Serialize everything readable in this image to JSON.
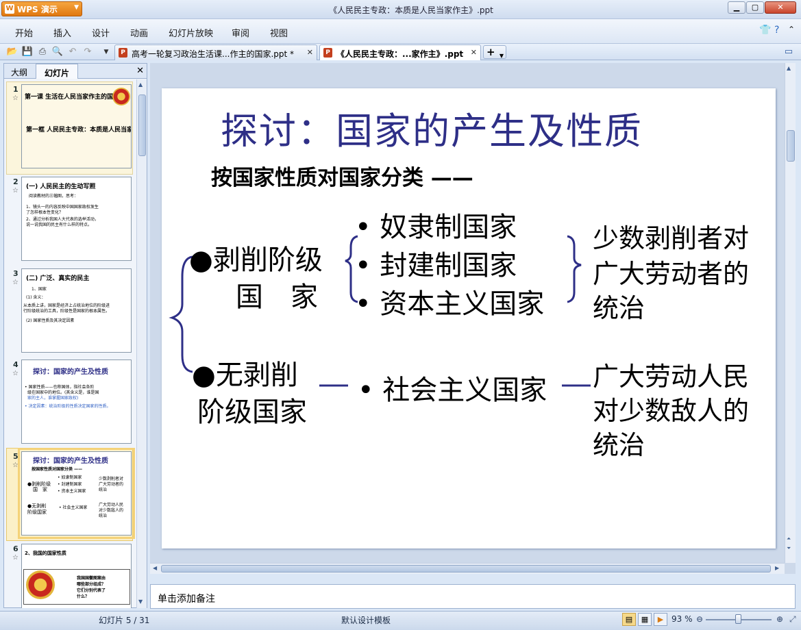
{
  "app": {
    "name": "WPS 演示",
    "window_title": "《人民民主专政：本质是人民当家作主》.ppt"
  },
  "menu": [
    "开始",
    "插入",
    "设计",
    "动画",
    "幻灯片放映",
    "审阅",
    "视图"
  ],
  "doc_tabs": [
    {
      "label": "高考一轮复习政治生活课...作主的国家.ppt *",
      "active": false
    },
    {
      "label": "《人民民主专政：...家作主》.ppt",
      "active": true
    }
  ],
  "left_pane": {
    "tab_outline": "大纲",
    "tab_slides": "幻灯片"
  },
  "thumbnails": [
    {
      "num": "1",
      "lines": [
        "第一课 生活在人民当家作主的国家",
        "第一框 人民民主专政：本质是人民当家作主"
      ]
    },
    {
      "num": "2",
      "lines": [
        "(一) 人民民主的生动写照",
        "阅读教材的三幅图，思考：",
        "1、镜头一的内容反映中国国家政权发生",
        "了怎样根本性变化？",
        "2、通过分析我国人大代表的选举活动，",
        "说一说我国的民主有什么样的特点。"
      ]
    },
    {
      "num": "3",
      "lines": [
        "(二) 广泛、真实的民主",
        "1、国家",
        "(1) 含义：",
        "从本质上讲，国家是经济上占统治地位的阶级进",
        "行阶级统治的工具，阶级性是国家的根本属性。",
        "(2) 国家性质及其决定因素"
      ]
    },
    {
      "num": "4",
      "lines": [
        "探讨：国家的产生及性质",
        "• 国家性质——也称国体，指社会各阶",
        "级在国家中的地位。(其含义是，谁是国",
        "家的主人，谁掌握国家政权)",
        "• 决定因素：统治阶级的性质决定国家的性质。"
      ]
    },
    {
      "num": "5",
      "lines": [
        "探讨：国家的产生及性质",
        "按国家性质对国家分类 ——"
      ]
    },
    {
      "num": "6",
      "lines": [
        "2、我国的国家性质",
        "我国国徽图案由",
        "哪些部分组成？",
        "它们分别代表了",
        "什么？"
      ]
    }
  ],
  "slide": {
    "title": "探讨：国家的产生及性质",
    "subtitle": "按国家性质对国家分类 ——",
    "group1": "●剥削阶级",
    "group1b": "国　家",
    "exploit_states": [
      "• 奴隶制国家",
      "• 封建制国家",
      "• 资本主义国家"
    ],
    "exploit_nature": [
      "少数剥削者对",
      "广大劳动者的",
      "统治"
    ],
    "group2": "●无剥削",
    "group2b": "阶级国家",
    "socialist": "• 社会主义国家",
    "socialist_nature": [
      "广大劳动人民",
      "对少数敌人的",
      "统治"
    ]
  },
  "notes_placeholder": "单击添加备注",
  "status": {
    "slide_counter": "幻灯片 5 / 31",
    "template": "默认设计模板",
    "zoom": "93 %"
  },
  "colors": {
    "title": "#2e2f87",
    "bracket": "#2e2f87",
    "accent": "#e07810"
  }
}
